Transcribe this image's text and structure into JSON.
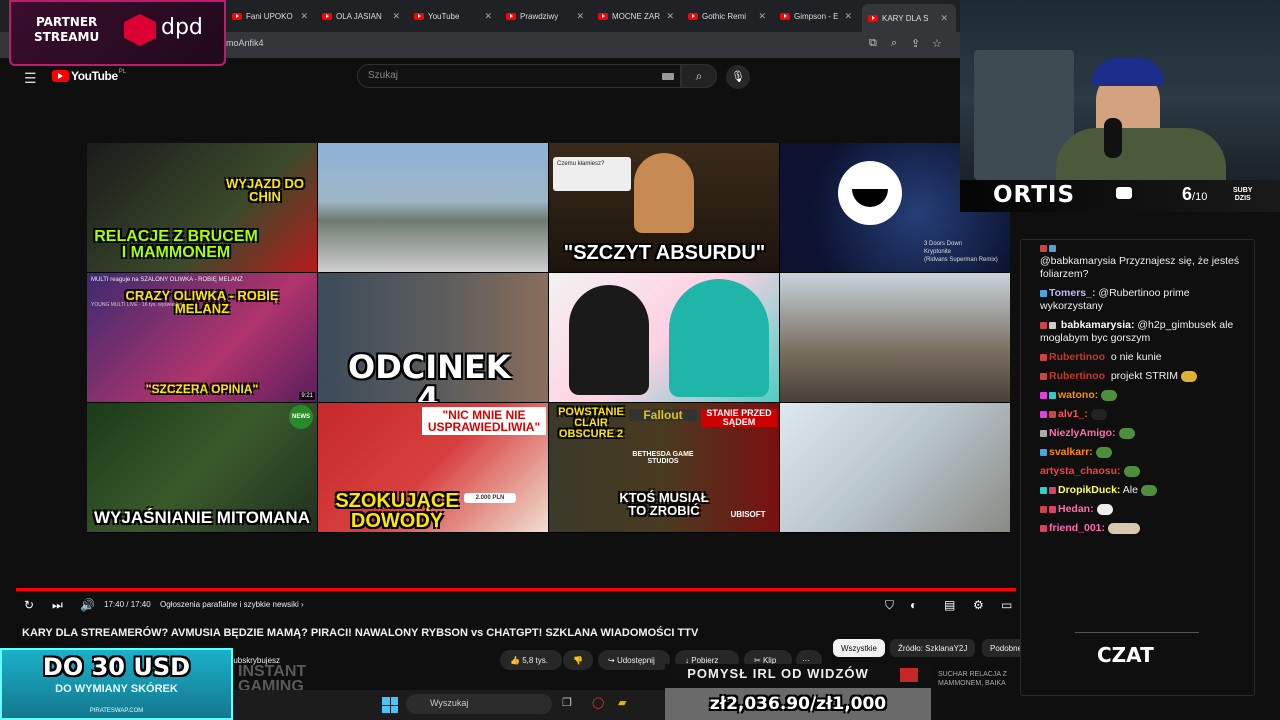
{
  "browser": {
    "tabs": [
      {
        "label": "Fani UPOKO"
      },
      {
        "label": "OLA JASIAN"
      },
      {
        "label": "YouTube"
      },
      {
        "label": "Prawdziwy"
      },
      {
        "label": "MOCNE ZAR"
      },
      {
        "label": "Gothic Remi"
      },
      {
        "label": "Gimpson - E"
      },
      {
        "label": "KARY DLA S"
      }
    ],
    "url": "moAnfik4"
  },
  "youtube": {
    "logo_text": "YouTube",
    "logo_region": "PL",
    "search_placeholder": "Szukaj"
  },
  "end_screen": [
    {
      "caption_top": "WYJAZD DO CHIN",
      "caption_bottom": "RELACJE Z BRUCEM I MAMMONEM",
      "meta": "..."
    },
    {
      "caption_top": "",
      "caption_bottom": "",
      "meta": ""
    },
    {
      "caption_top": "\"SZCZYT ABSURDU\"",
      "caption_bottom": "",
      "comment": "Czemu kłamiesz?"
    },
    {
      "caption_top": "3 Doors Down",
      "caption_bottom": "Kryptonite",
      "meta": "(Ridvans Superman Remix)"
    },
    {
      "caption_top": "MULTI reaguje na SZALONY OLIWKA - ROBIĘ MELANZ",
      "caption_bottom": "\"SZCZERA OPINIA\"",
      "meta": "YOUNG MULTI LIVE · 16 tys. wyświetleń",
      "duration": "9:21",
      "overlay": "CRAZY OLIWKA - ROBIĘ MELANZ"
    },
    {
      "caption_top": "",
      "caption_bottom": "ODCINEK 4",
      "meta": ""
    },
    {
      "caption_top": "",
      "caption_bottom": "",
      "meta": ""
    },
    {
      "caption_top": "",
      "caption_bottom": "",
      "meta": ""
    },
    {
      "caption_top": "",
      "caption_bottom": "WYJAŚNIANIE MITOMANA",
      "meta": "NEWS"
    },
    {
      "caption_top": "\"NIC MNIE NIE USPRAWIEDLIWIA\"",
      "caption_bottom": "SZOKUJĄCE DOWODY",
      "meta": "2.000 PLN"
    },
    {
      "caption_top": "POWSTANIE CLAIR OBSCURE 2",
      "caption_bottom": "KTOŚ MUSIAŁ TO ZROBIĆ",
      "meta": "Fallout",
      "meta2": "BETHESDA GAME STUDIOS",
      "meta3": "STANIE PRZED SĄDEM",
      "meta4": "UBISOFT"
    },
    {
      "caption_top": "",
      "caption_bottom": "",
      "meta": ""
    }
  ],
  "player": {
    "time": "17:40 / 17:40",
    "chapter": "Ogłoszenia parafialne i szybkie newsiki ›",
    "title": "KARY DLA STREAMERÓW? AVMUSIA BĘDZIE MAMĄ? PIRACI! NAWALONY RYBSON vs CHATGPT! SZKLANA WIADOMOŚCI TTV",
    "subscribed": "Subskrybujesz",
    "likes": "5,8 tys.",
    "share": "Udostępnij",
    "download": "Pobierz",
    "clip": "Klip",
    "more": "···",
    "chips": [
      "Wszystkie",
      "Źródło: SzklanaY2J",
      "Podobne"
    ]
  },
  "webcam": {
    "name": "ORTIS",
    "subs_value": "6",
    "subs_goal": "/10",
    "subs_label_1": "SUBY",
    "subs_label_2": "DZIS"
  },
  "chat": {
    "messages": [
      {
        "user": "",
        "text": "@babkamarysia Przyznajesz się, że jesteś foliarzem?",
        "color": "#ffffff"
      },
      {
        "user": "Tomers_:",
        "text": "@Rubertinoo prime wykorzystany",
        "color": "#ffffff"
      },
      {
        "user": "babkamarysia:",
        "text": "@h2p_gimbusek ale moglabym byc gorszym",
        "color": "#ffffff"
      },
      {
        "user": "Rubertinoo",
        "text": "o nie kunie",
        "color": "#c0392b"
      },
      {
        "user": "Rubertinoo",
        "text": "projekt STRIM",
        "color": "#c0392b"
      },
      {
        "user": "watono:",
        "text": "",
        "color": "#ff8c00"
      },
      {
        "user": "alv1_:",
        "text": "",
        "color": "#ff5555"
      },
      {
        "user": "NiezlyAmigo:",
        "text": "",
        "color": "#ff69b4"
      },
      {
        "user": "svalkarr:",
        "text": "",
        "color": "#ff8c00"
      },
      {
        "user": "artysta_chaosu:",
        "text": "",
        "color": "#ff3b3b"
      },
      {
        "user": "DropikDuck:",
        "text": "Ale",
        "color": "#ffff66"
      },
      {
        "user": "Hedan:",
        "text": "",
        "color": "#ff69b4"
      },
      {
        "user": "friend_001:",
        "text": "",
        "color": "#ff69b4"
      }
    ],
    "footer": "CZAT"
  },
  "overlays": {
    "partner_line1": "PARTNER",
    "partner_line2": "STREAMU",
    "partner_brand": "dpd",
    "promo_big": "DO 30 USD",
    "promo_small": "DO WYMIANY SKÓREK",
    "promo_site": "PIRATESWAP.COM",
    "instant_line1": "INSTANT",
    "instant_line2": "GAMING",
    "goal_title": "POMYSŁ IRL OD WIDZÓW",
    "goal_amount": "zł2,036.90/zł1,000",
    "suchar_line1": "SUCHAR RELACJA Z",
    "suchar_line2": "MAMMONEM, BAIKA",
    "taskbar_search": "Wyszukaj"
  }
}
